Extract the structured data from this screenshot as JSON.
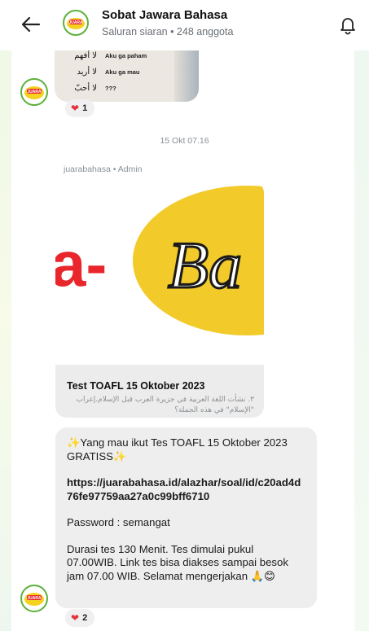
{
  "header": {
    "title": "Sobat Jawara Bahasa",
    "subtitle": "Saluran siaran • 248 anggota"
  },
  "avatar_label": "JUARA",
  "top_image": {
    "rows": [
      {
        "arabic": "لا أفهم",
        "indo": "Aku ga paham"
      },
      {
        "arabic": "لا أريد",
        "indo": "Aku ga mau"
      },
      {
        "arabic": "لا أحبّ",
        "indo": "???"
      }
    ]
  },
  "reaction_top": {
    "emoji": "❤",
    "count": "1"
  },
  "timestamp": "15 Okt 07.16",
  "sender": "juarabahasa • Admin",
  "poster": {
    "graphic_text_left": "a-",
    "graphic_text_right": "Ba",
    "title": "Test TOAFL 15 Oktober 2023",
    "arabic": "٣. نشأت اللغة العربية في جزيرة العرب قبل الإسلام.إعراب \"الإسلام\" في هذه الجملة؟"
  },
  "message": {
    "line1": "✨Yang mau ikut Tes TOAFL  15 Oktober 2023 GRATISS✨",
    "link": "https://juarabahasa.id/alazhar/soal/id/c20ad4d76fe97759aa27a0c99bff6710",
    "password": "Password : semangat",
    "details": "Durasi tes 130 Menit. Tes dimulai pukul 07.00WIB. Link tes bisa diakses sampai besok jam 07.00 WIB. Selamat mengerjakan 🙏😊"
  },
  "reaction_bottom": {
    "emoji": "❤",
    "count": "2"
  },
  "colors": {
    "poster_red": "#e8262b",
    "poster_yellow": "#f2ca29",
    "avatar_green": "#5cb13a",
    "heart_red": "#e0383e"
  }
}
